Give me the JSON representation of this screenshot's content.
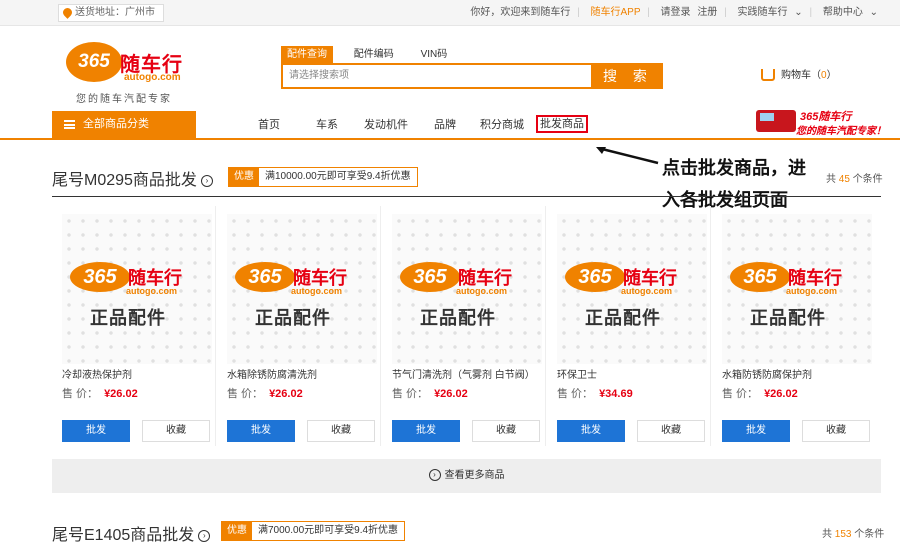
{
  "topbar": {
    "location": "送货地址：广州市",
    "greeting": "你好，欢迎来到随车行",
    "app": "随车行APP",
    "login": "请登录",
    "register": "注册",
    "brand_link": "实践随车行",
    "help": "帮助中心"
  },
  "logo": {
    "number": "365",
    "name": "随车行",
    "domain": "autogo.com",
    "slogan": "您的随车汽配专家"
  },
  "search": {
    "tabs": [
      "配件查询",
      "配件编码",
      "VIN码"
    ],
    "active_tab": 0,
    "placeholder": "请选择搜索项",
    "button": "搜 索"
  },
  "cart": {
    "label": "购物车",
    "count": "0"
  },
  "nav": {
    "all_categories": "全部商品分类",
    "items": [
      "首页",
      "车系",
      "发动机件",
      "品牌",
      "积分商城",
      "批发商品"
    ],
    "highlighted_item": "批发商品"
  },
  "ad": {
    "line1": "365随车行",
    "line2": "您的随车汽配专家！"
  },
  "annotation": {
    "line1": "点击批发商品，进",
    "line2": "入各批发组页面"
  },
  "sections": [
    {
      "title": "尾号M0295商品批发",
      "promo_tag": "优惠",
      "promo_text": "满10000.00元即可享受9.4折优惠",
      "count_prefix": "共",
      "count": "45",
      "count_suffix": "个条件"
    },
    {
      "title": "尾号E1405商品批发",
      "promo_tag": "优惠",
      "promo_text": "满7000.00元即可享受9.4折优惠",
      "count_prefix": "共",
      "count": "153",
      "count_suffix": "个条件"
    }
  ],
  "placeholder_image": {
    "number": "365",
    "name": "随车行",
    "domain": "autogo.com",
    "caption": "正品配件"
  },
  "products": [
    {
      "name": "冷却液热保护剂",
      "price_label": "售  价：",
      "price": "¥26.02",
      "wholesale": "批发",
      "favorite": "收藏"
    },
    {
      "name": "水箱除锈防腐清洗剂",
      "price_label": "售  价：",
      "price": "¥26.02",
      "wholesale": "批发",
      "favorite": "收藏"
    },
    {
      "name": "节气门清洗剂（气雾剂 白节阀）",
      "price_label": "售  价：",
      "price": "¥26.02",
      "wholesale": "批发",
      "favorite": "收藏"
    },
    {
      "name": "环保卫士",
      "price_label": "售  价：",
      "price": "¥34.69",
      "wholesale": "批发",
      "favorite": "收藏"
    },
    {
      "name": "水箱防锈防腐保护剂",
      "price_label": "售  价：",
      "price": "¥26.02",
      "wholesale": "批发",
      "favorite": "收藏"
    }
  ],
  "more_link": "查看更多商品",
  "colors": {
    "accent": "#f08200",
    "price": "#e60012",
    "button_blue": "#1e74d6",
    "highlight_box": "#e60012"
  }
}
